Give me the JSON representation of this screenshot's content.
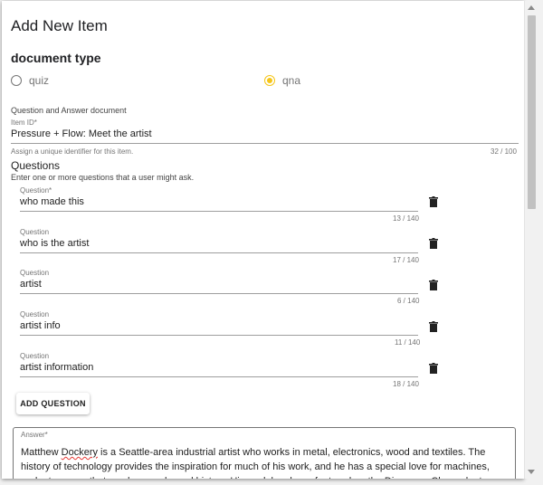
{
  "dialog": {
    "title": "Add New Item"
  },
  "doc_type": {
    "heading": "document type",
    "options": [
      {
        "label": "quiz",
        "selected": false
      },
      {
        "label": "qna",
        "selected": true
      }
    ],
    "accent_color": "#f5c518"
  },
  "qna": {
    "subtitle": "Question and Answer document",
    "item_id": {
      "label": "Item ID*",
      "value": "Pressure + Flow: Meet the artist",
      "hint": "Assign a unique identifier for this item.",
      "counter": "32 / 100"
    },
    "questions_heading": "Questions",
    "questions_hint": "Enter one or more questions that a user might ask.",
    "questions": [
      {
        "label": "Question*",
        "value": "who made this",
        "counter": "13 / 140"
      },
      {
        "label": "Question",
        "value": "who is the artist",
        "counter": "17 / 140"
      },
      {
        "label": "Question",
        "value": "artist",
        "counter": "6 / 140"
      },
      {
        "label": "Question",
        "value": "artist info",
        "counter": "11 / 140"
      },
      {
        "label": "Question",
        "value": "artist information",
        "counter": "18 / 140"
      }
    ],
    "add_question_label": "ADD QUESTION",
    "answer": {
      "label": "Answer*",
      "word_misspelled": "Dockery",
      "text_before": "Matthew ",
      "text_after": " is a Seattle-area industrial artist who works in metal, electronics, wood and textiles. The history of technology provides the inspiration for much of his work, and he has a special love for machines, gadgets, gears that mesh properly, and history. His work has been featured on the Discovery Channel, at Greenwich Observatory in London, at the"
    }
  }
}
